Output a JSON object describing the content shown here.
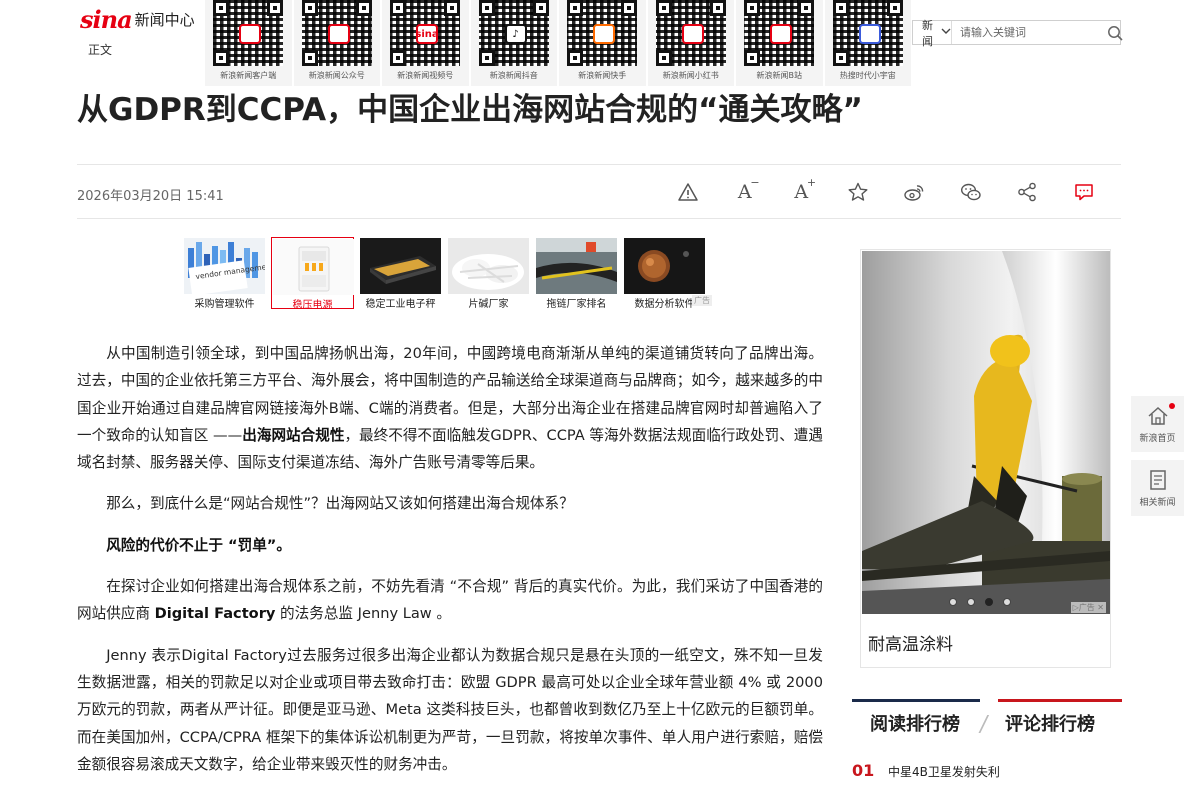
{
  "header": {
    "logo_mark": "sina",
    "logo_site": "新闻中心",
    "section": "正文",
    "qr_codes": [
      {
        "label": "新浪新闻客户端",
        "center": "",
        "color": "#e60012"
      },
      {
        "label": "新浪新闻公众号",
        "center": "",
        "color": "#e60012"
      },
      {
        "label": "新浪新闻视频号",
        "center": "sina",
        "color": "#e60012"
      },
      {
        "label": "新浪新闻抖音",
        "center": "♪",
        "color": "#111111"
      },
      {
        "label": "新浪新闻快手",
        "center": "",
        "color": "#ff6a00"
      },
      {
        "label": "新浪新闻小红书",
        "center": "",
        "color": "#e60012"
      },
      {
        "label": "新浪新闻B站",
        "center": "",
        "color": "#e60012"
      },
      {
        "label": "热搜时代小宇宙",
        "center": "",
        "color": "#3b5bdb"
      }
    ],
    "search": {
      "category": "新闻",
      "placeholder": "请输入关键词"
    }
  },
  "article": {
    "title": "从GDPR到CCPA，中国企业出海网站合规的“通关攻略”",
    "date": "2026年03月20日 15:41",
    "toolbar": [
      {
        "name": "report-icon"
      },
      {
        "name": "font-smaller-icon",
        "text": "A"
      },
      {
        "name": "font-larger-icon",
        "text": "A"
      },
      {
        "name": "favorite-icon"
      },
      {
        "name": "weibo-share-icon"
      },
      {
        "name": "wechat-share-icon"
      },
      {
        "name": "share-icon"
      },
      {
        "name": "comment-icon"
      }
    ],
    "ads": [
      {
        "label": "采购管理软件",
        "active": false
      },
      {
        "label": "稳压电源",
        "active": true
      },
      {
        "label": "稳定工业电子秤",
        "active": false
      },
      {
        "label": "片碱厂家",
        "active": false
      },
      {
        "label": "拖链厂家排名",
        "active": false
      },
      {
        "label": "数据分析软件",
        "active": false
      }
    ],
    "ad_flag": "广告",
    "ad_thumb_text": "vendor management",
    "p1_part1": "从中国制造引领全球，到中国品牌扬帆出海，20年间，中國跨境电商渐渐从单纯的渠道铺货转向了品牌出海。过去，中国的企业依托第三方平台、海外展会，将中国制造的产品输送给全球渠道商与品牌商；如今，越来越多的中国企业开始通过自建品牌官网链接海外B端、C端的消费者。但是，大部分出海企业在搭建品牌官网时却普遍陷入了一个致命的认知盲区 ——",
    "p1_bold": "出海网站合规性",
    "p1_part2": "，最终不得不面临触发GDPR、CCPA 等海外数据法规面临行政处罚、遭遇域名封禁、服务器关停、国际支付渠道冻结、海外广告账号清零等后果。",
    "p2": "那么，到底什么是“网站合规性”？出海网站又该如何搭建出海合规体系？",
    "p3_heading": "风险的代价不止于 “罚单”。",
    "p4_part1": "在探讨企业如何搭建出海合规体系之前，不妨先看清 “不合规” 背后的真实代价。为此，我们采访了中国香港的网站供应商 ",
    "p4_bold": "Digital Factory",
    "p4_part2": " 的法务总监 Jenny Law 。",
    "p5": "Jenny 表示Digital Factory过去服务过很多出海企业都认为数据合规只是悬在头顶的一纸空文，殊不知一旦发生数据泄露，相关的罚款足以对企业或项目带去致命打击：欧盟 GDPR 最高可处以企业全球年营业额 4% 或 2000 万欧元的罚款，两者从严计征。即便是亚马逊、Meta 这类科技巨头，也都曾收到数亿乃至上十亿欧元的巨额罚单。而在美国加州，CCPA/CPRA 框架下的集体诉讼机制更为严苛，一旦罚款，将按单次事件、单人用户进行索赔，赔偿金额很容易滚成天文数字，给企业带来毁灭性的财务冲击。"
  },
  "sidebar": {
    "ad": {
      "caption": "耐高温涂料",
      "dots": [
        false,
        false,
        true,
        false
      ],
      "mark": "▷广告 ✕"
    },
    "ranking": {
      "tab_read": "阅读排行榜",
      "tab_comment": "评论排行榜",
      "sep": "/",
      "items": [
        {
          "num": "01",
          "text": "中星4B卫星发射失利"
        }
      ]
    }
  },
  "float_nav": {
    "home": "新浪首页",
    "related": "相关新闻"
  },
  "colors": {
    "brand_red": "#e60012",
    "rank_red": "#c8161d",
    "rank_navy": "#1a2a4a"
  }
}
